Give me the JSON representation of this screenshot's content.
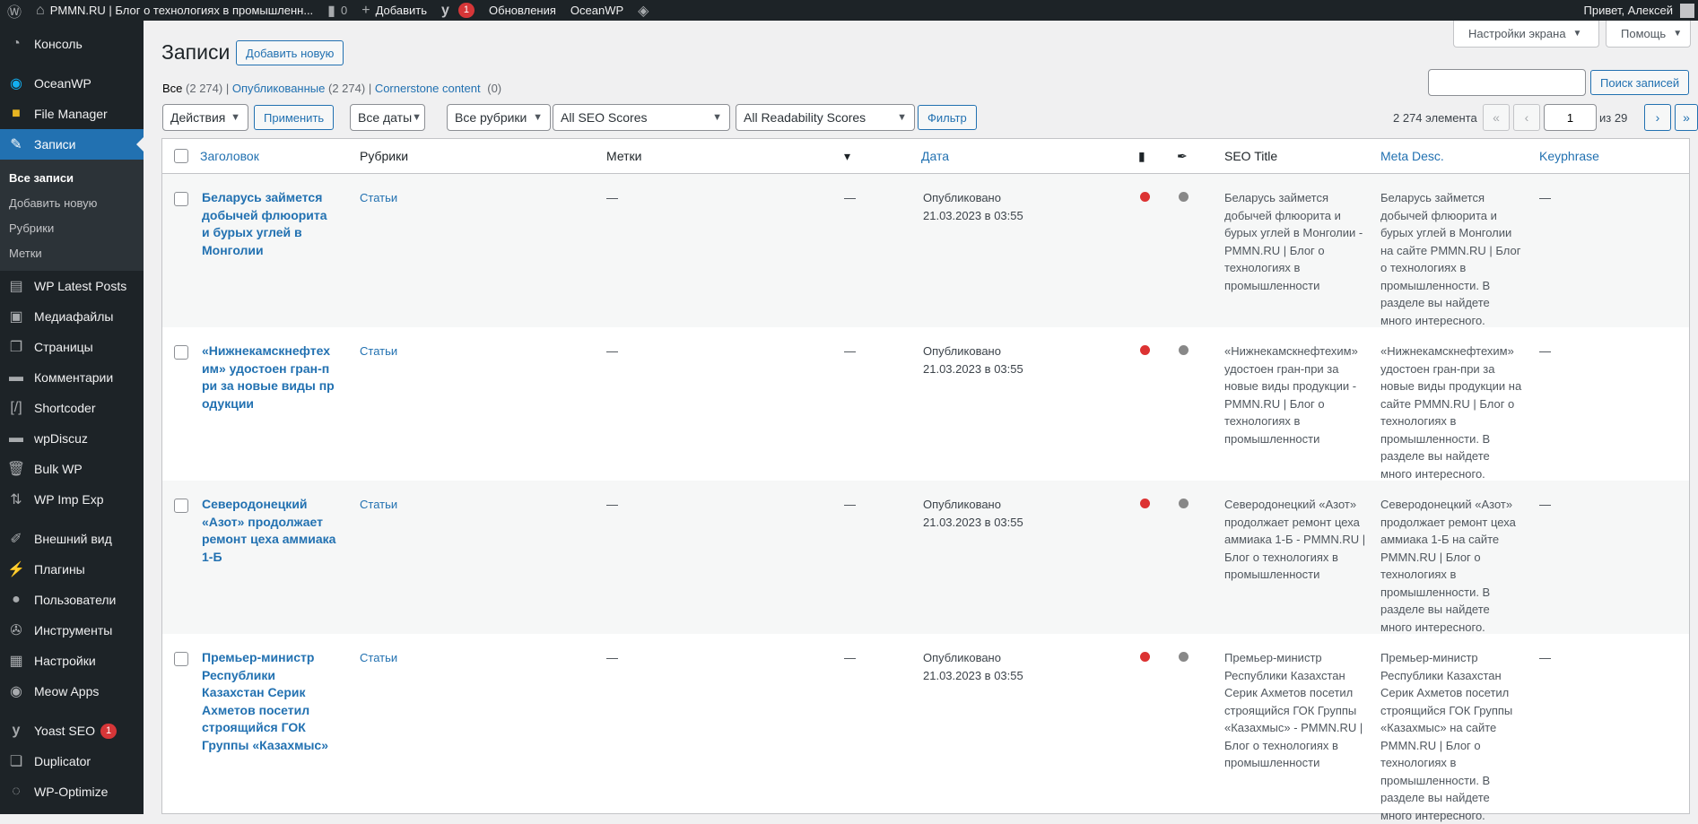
{
  "adminbar": {
    "site_title": "PMMN.RU | Блог о технологиях в промышленн...",
    "comments_count": "0",
    "add_new": "Добавить",
    "yoast_badge": "1",
    "updates": "Обновления",
    "theme": "OceanWP",
    "greeting": "Привет, Алексей"
  },
  "sidebar": {
    "items": [
      {
        "label": "Консоль",
        "icon": "dashboard-icon"
      },
      {
        "label": "OceanWP",
        "icon": "oceanwp-icon"
      },
      {
        "label": "File Manager",
        "icon": "folder-icon"
      },
      {
        "label": "Записи",
        "icon": "pushpin-icon"
      },
      {
        "label": "WP Latest Posts",
        "icon": "latest-posts-icon"
      },
      {
        "label": "Медиафайлы",
        "icon": "media-icon"
      },
      {
        "label": "Страницы",
        "icon": "pages-icon"
      },
      {
        "label": "Комментарии",
        "icon": "comments-icon"
      },
      {
        "label": "Shortcoder",
        "icon": "shortcoder-icon"
      },
      {
        "label": "wpDiscuz",
        "icon": "wpdiscuz-icon"
      },
      {
        "label": "Bulk WP",
        "icon": "trash-icon"
      },
      {
        "label": "WP Imp Exp",
        "icon": "import-export-icon"
      },
      {
        "label": "Внешний вид",
        "icon": "appearance-icon"
      },
      {
        "label": "Плагины",
        "icon": "plugins-icon"
      },
      {
        "label": "Пользователи",
        "icon": "users-icon"
      },
      {
        "label": "Инструменты",
        "icon": "tools-icon"
      },
      {
        "label": "Настройки",
        "icon": "settings-icon"
      },
      {
        "label": "Meow Apps",
        "icon": "meow-apps-icon"
      },
      {
        "label": "Yoast SEO",
        "icon": "yoast-icon",
        "badge": "1"
      },
      {
        "label": "Duplicator",
        "icon": "duplicator-icon"
      },
      {
        "label": "WP-Optimize",
        "icon": "optimize-icon"
      }
    ],
    "submenu": [
      "Все записи",
      "Добавить новую",
      "Рубрики",
      "Метки"
    ]
  },
  "header": {
    "screen_options": "Настройки экрана",
    "help": "Помощь",
    "title": "Записи",
    "add_new": "Добавить новую"
  },
  "views": {
    "all": "Все",
    "all_count": "(2 274)",
    "published": "Опубликованные",
    "published_count": "(2 274)",
    "cornerstone": "Cornerstone content",
    "cornerstone_count": "(0)"
  },
  "search": {
    "value": "",
    "button": "Поиск записей"
  },
  "filters": {
    "bulk_action": "Действия",
    "apply": "Применить",
    "dates": "Все даты",
    "categories": "Все рубрики",
    "seo_scores": "All SEO Scores",
    "readability_scores": "All Readability Scores",
    "filter_button": "Фильтр"
  },
  "pagination": {
    "items": "2 274 элемента",
    "first": "«",
    "prev": "‹",
    "current_page": "1",
    "of": "из 29",
    "next": "›",
    "last": "»"
  },
  "table": {
    "columns": {
      "title": "Заголовок",
      "categories": "Рубрики",
      "tags": "Метки",
      "date": "Дата",
      "seo_title": "SEO Title",
      "meta_desc": "Meta Desc.",
      "keyphrase": "Keyphrase"
    },
    "rows": [
      {
        "title": "Беларусь займется добычей флюорита и бурых углей в Монголии",
        "category": "Статьи",
        "tags": "—",
        "comments": "—",
        "status": "Опубликовано",
        "date": "21.03.2023 в 03:55",
        "seo_score": "red",
        "readability_score": "gray",
        "seo_title": "Беларусь займется добычей флюорита и бурых углей в Монголии - PMMN.RU | Блог о технологиях в промышленности",
        "meta_desc": "Беларусь займется добычей флюорита и бурых углей в Монголии на сайте PMMN.RU | Блог о технологиях в промышленности. В разделе вы найдете много интересного.",
        "keyphrase": "—"
      },
      {
        "title": "«Нижнекамскнефтехим» удостоен гран-при за новые виды продукции",
        "category": "Статьи",
        "tags": "—",
        "comments": "—",
        "status": "Опубликовано",
        "date": "21.03.2023 в 03:55",
        "seo_score": "red",
        "readability_score": "gray",
        "seo_title": "«Нижнекамскнефтехим» удостоен гран-при за новые виды продукции - PMMN.RU | Блог о технологиях в промышленности",
        "meta_desc": "«Нижнекамскнефтехим» удостоен гран-при за новые виды продукции на сайте PMMN.RU | Блог о технологиях в промышленности. В разделе вы найдете много интересного.",
        "keyphrase": "—"
      },
      {
        "title": "Северодонецкий «Азот» продолжает ремонт цеха аммиака 1-Б",
        "category": "Статьи",
        "tags": "—",
        "comments": "—",
        "status": "Опубликовано",
        "date": "21.03.2023 в 03:55",
        "seo_score": "red",
        "readability_score": "gray",
        "seo_title": "Северодонецкий «Азот» продолжает ремонт цеха аммиака 1-Б - PMMN.RU | Блог о технологиях в промышленности",
        "meta_desc": "Северодонецкий «Азот» продолжает ремонт цеха аммиака 1-Б на сайте PMMN.RU | Блог о технологиях в промышленности. В разделе вы найдете много интересного.",
        "keyphrase": "—"
      },
      {
        "title": "Премьер-министр Республики Казахстан Серик Ахметов посетил строящийся ГОК Группы «Казахмыс»",
        "category": "Статьи",
        "tags": "—",
        "comments": "—",
        "status": "Опубликовано",
        "date": "21.03.2023 в 03:55",
        "seo_score": "red",
        "readability_score": "gray",
        "seo_title": "Премьер-министр Республики Казахстан Серик Ахметов посетил строящийся ГОК Группы «Казахмыс» - PMMN.RU | Блог о технологиях в промышленности",
        "meta_desc": "Премьер-министр Республики Казахстан Серик Ахметов посетил строящийся ГОК Группы «Казахмыс» на сайте PMMN.RU | Блог о технологиях в промышленности. В разделе вы найдете много интересного.",
        "keyphrase": "—"
      }
    ]
  },
  "colors": {
    "accent": "#2271b1",
    "sidebar": "#1d2327",
    "seo_bad": "#dc3232",
    "neutral": "#888888"
  }
}
